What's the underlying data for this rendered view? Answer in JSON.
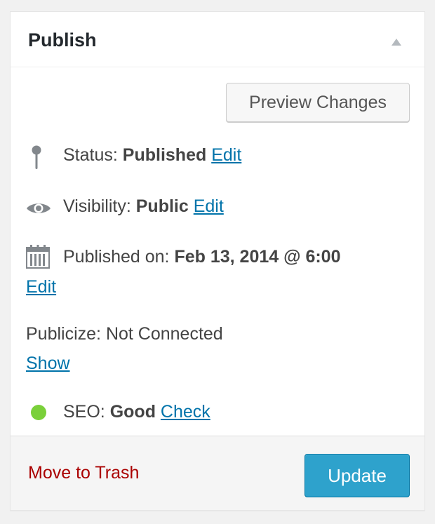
{
  "panel": {
    "title": "Publish",
    "preview_label": "Preview Changes"
  },
  "status": {
    "label": "Status:",
    "value": "Published",
    "action": "Edit",
    "icon": "pin-icon"
  },
  "visibility": {
    "label": "Visibility:",
    "value": "Public",
    "action": "Edit",
    "icon": "eye-icon"
  },
  "published": {
    "label": "Published on:",
    "value": "Feb 13, 2014 @ 6:00",
    "action": "Edit",
    "icon": "calendar-icon"
  },
  "publicize": {
    "text": "Publicize: Not Connected",
    "action": "Show"
  },
  "seo": {
    "label": "SEO:",
    "value": "Good",
    "action": "Check",
    "status_color": "#7ad03a"
  },
  "footer": {
    "trash_label": "Move to Trash",
    "update_label": "Update"
  },
  "colors": {
    "link": "#0073aa",
    "trash": "#aa0000",
    "primary_button": "#2ea2cc"
  }
}
